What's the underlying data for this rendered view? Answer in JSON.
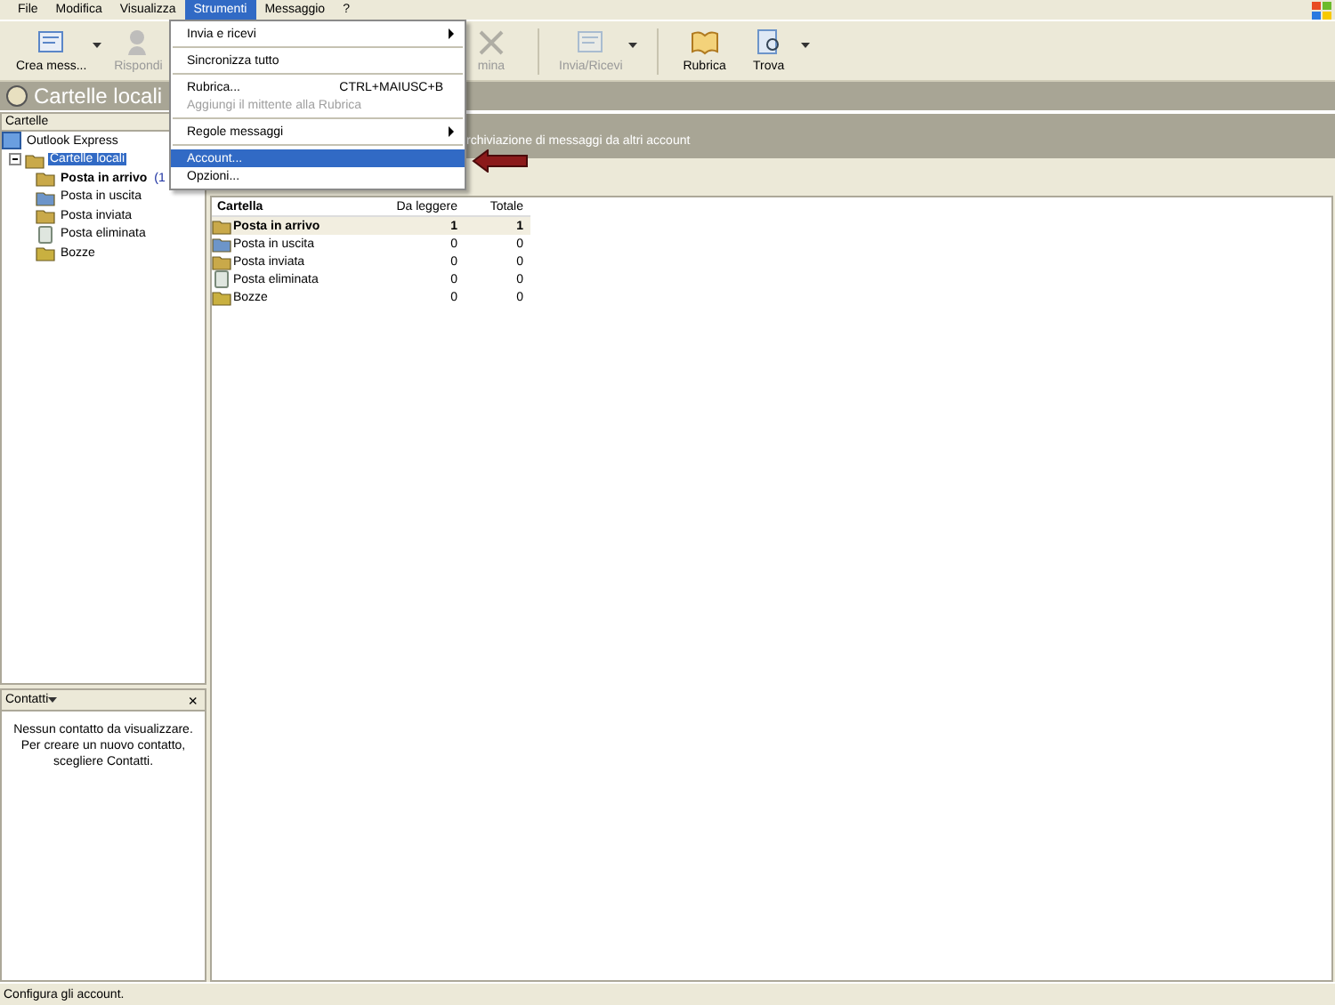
{
  "menu_bar": [
    {
      "label": "File",
      "selected": false
    },
    {
      "label": "Modifica",
      "selected": false
    },
    {
      "label": "Visualizza",
      "selected": false
    },
    {
      "label": "Strumenti",
      "selected": true
    },
    {
      "label": "Messaggio",
      "selected": false
    },
    {
      "label": "?",
      "selected": false
    }
  ],
  "toolbar": [
    {
      "label": "Crea mess...",
      "disabled": false,
      "dropdown": true
    },
    {
      "label": "Rispondi",
      "disabled": true,
      "dropdown": false
    },
    {
      "label": "mina",
      "disabled": true,
      "dropdown": false
    },
    {
      "label": "Invia/Ricevi",
      "disabled": true,
      "dropdown": true
    },
    {
      "label": "Rubrica",
      "disabled": false,
      "dropdown": false
    },
    {
      "label": "Trova",
      "disabled": false,
      "dropdown": true
    }
  ],
  "title": "Cartelle locali",
  "folder_pane": {
    "header": "Cartelle",
    "tree": [
      {
        "label": "Outlook Express",
        "selected": false,
        "children": [
          {
            "label": "Cartelle locali",
            "selected": true,
            "expanded": true,
            "children": [
              {
                "label": "Posta in arrivo",
                "selected": false,
                "bold": true,
                "count": "(1"
              },
              {
                "label": "Posta in uscita",
                "selected": false,
                "bold": false
              },
              {
                "label": "Posta inviata",
                "selected": false,
                "bold": false
              },
              {
                "label": "Posta eliminata",
                "selected": false,
                "bold": false
              },
              {
                "label": "Bozze",
                "selected": false,
                "bold": false
              }
            ]
          }
        ]
      }
    ]
  },
  "contacts_pane": {
    "header": "Contatti",
    "close": "×",
    "message": "Nessun contatto da visualizzare. Per creare un nuovo contatto, scegliere Contatti."
  },
  "banner_text": "rchiviazione di messaggi da altri account",
  "table": {
    "columns": [
      "Cartella",
      "Da leggere",
      "Totale"
    ],
    "rows": [
      {
        "cells": [
          "Posta in arrivo",
          "1",
          "1"
        ],
        "bold": true,
        "selected": true
      },
      {
        "cells": [
          "Posta in uscita",
          "0",
          "0"
        ],
        "bold": false,
        "selected": false
      },
      {
        "cells": [
          "Posta inviata",
          "0",
          "0"
        ],
        "bold": false,
        "selected": false
      },
      {
        "cells": [
          "Posta eliminata",
          "0",
          "0"
        ],
        "bold": false,
        "selected": false
      },
      {
        "cells": [
          "Bozze",
          "0",
          "0"
        ],
        "bold": false,
        "selected": false
      }
    ]
  },
  "dropdown_menu": [
    {
      "kind": "item",
      "label": "Invia e ricevi",
      "submenu": true,
      "disabled": false,
      "selected": false
    },
    {
      "kind": "separator"
    },
    {
      "kind": "item",
      "label": "Sincronizza tutto",
      "submenu": false,
      "disabled": false,
      "selected": false
    },
    {
      "kind": "separator"
    },
    {
      "kind": "item",
      "label": "Rubrica...",
      "shortcut": "CTRL+MAIUSC+B",
      "submenu": false,
      "disabled": false,
      "selected": false
    },
    {
      "kind": "item",
      "label": "Aggiungi il mittente alla Rubrica",
      "submenu": false,
      "disabled": true,
      "selected": false
    },
    {
      "kind": "separator"
    },
    {
      "kind": "item",
      "label": "Regole messaggi",
      "submenu": true,
      "disabled": false,
      "selected": false
    },
    {
      "kind": "separator"
    },
    {
      "kind": "item",
      "label": "Account...",
      "submenu": false,
      "disabled": false,
      "selected": true
    },
    {
      "kind": "item",
      "label": "Opzioni...",
      "submenu": false,
      "disabled": false,
      "selected": false
    }
  ],
  "status_bar": "Configura gli account."
}
